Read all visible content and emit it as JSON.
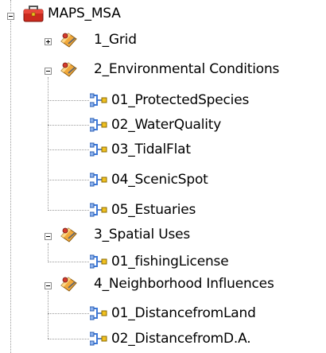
{
  "tree": {
    "root": {
      "label": "MAPS_MSA",
      "icon": "toolbox-icon",
      "expanded": true
    },
    "groups": [
      {
        "label": "1_Grid",
        "icon": "toolset-icon",
        "expanded": false,
        "children": []
      },
      {
        "label": "2_Environmental Conditions",
        "icon": "toolset-icon",
        "expanded": true,
        "children": [
          {
            "label": "01_ProtectedSpecies",
            "icon": "model-tool-icon"
          },
          {
            "label": "02_WaterQuality",
            "icon": "model-tool-icon"
          },
          {
            "label": "03_TidalFlat",
            "icon": "model-tool-icon"
          },
          {
            "label": "04_ScenicSpot",
            "icon": "model-tool-icon"
          },
          {
            "label": "05_Estuaries",
            "icon": "model-tool-icon"
          }
        ]
      },
      {
        "label": "3_Spatial Uses",
        "icon": "toolset-icon",
        "expanded": true,
        "children": [
          {
            "label": "01_fishingLicense",
            "icon": "model-tool-icon"
          }
        ]
      },
      {
        "label": "4_Neighborhood Influences",
        "icon": "toolset-icon",
        "expanded": true,
        "children": [
          {
            "label": "01_DistancefromLand",
            "icon": "model-tool-icon"
          },
          {
            "label": "02_DistancefromD.A.",
            "icon": "model-tool-icon"
          }
        ]
      }
    ]
  }
}
